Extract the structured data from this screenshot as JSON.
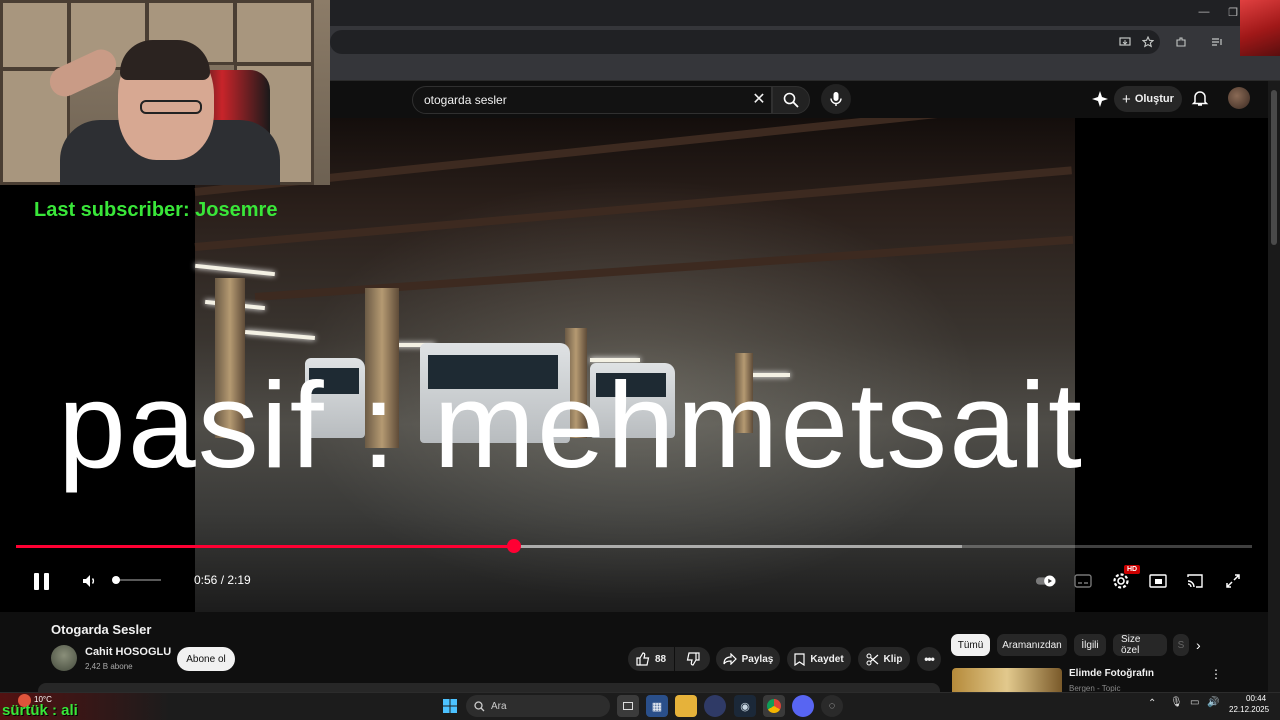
{
  "browser": {
    "window_controls": {
      "minimize": "—",
      "restore": "❐"
    }
  },
  "youtube": {
    "search": {
      "query": "otogarda sesler"
    },
    "header": {
      "create_label": "Oluştur"
    }
  },
  "stream_overlay": {
    "last_subscriber": "Last subscriber: Josemre",
    "chat_text": "sürtük : ali"
  },
  "video": {
    "overlay_text": "pasif : mehmetsait",
    "time": "0:56 / 2:19",
    "progress_fraction": 0.403,
    "buffered_fraction": 0.765,
    "volume_fraction": 0.05,
    "hd_badge": "HD"
  },
  "below_video": {
    "title": "Otogarda Sesler",
    "channel": {
      "name": "Cahit HOSOGLU",
      "subscribers": "2,42 B abone"
    },
    "subscribe_label": "Abone ol",
    "actions": {
      "likes": "88",
      "share": "Paylaş",
      "save": "Kaydet",
      "clip": "Klip"
    }
  },
  "sidebar": {
    "chips": [
      "Tümü",
      "Aramanızdan",
      "İlgili",
      "Size özel",
      "S"
    ],
    "recommendation": {
      "title": "Elimde Fotoğrafın",
      "channel": "Bergen - Topic"
    }
  },
  "taskbar": {
    "weather_temp": "10°C",
    "search_placeholder": "Ara",
    "time": "00:44",
    "date": "22.12.2025"
  },
  "colors": {
    "youtube_red": "#ff0033",
    "subscriber_green": "#39e639",
    "background": "#0f0f0f"
  }
}
